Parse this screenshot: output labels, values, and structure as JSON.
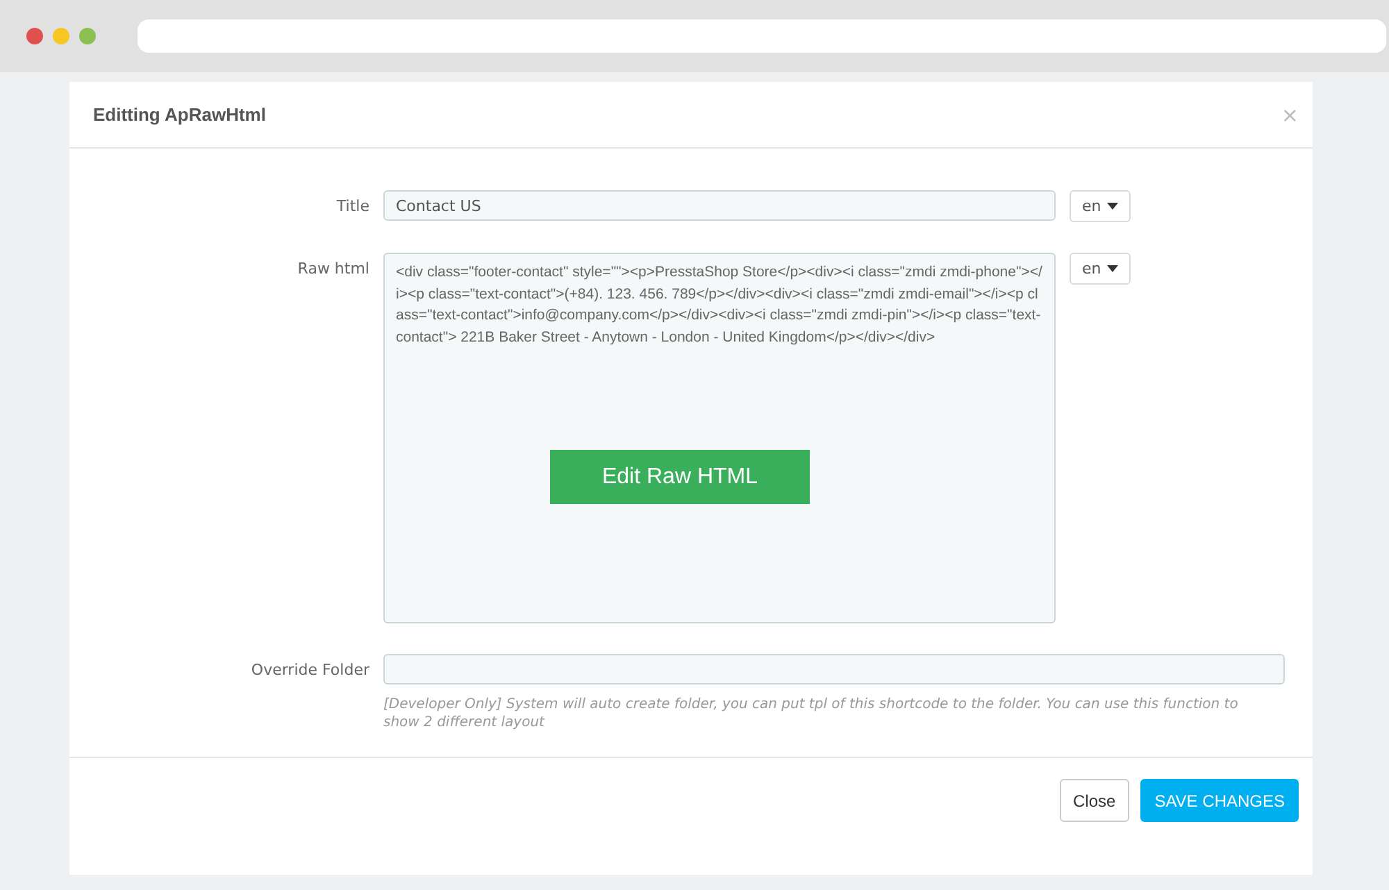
{
  "modal": {
    "title": "Editting ApRawHtml",
    "close_icon": "×"
  },
  "fields": [
    {
      "kind": "input",
      "label": "Title",
      "value": "Contact US",
      "lang": "en"
    },
    {
      "kind": "code",
      "label": "Raw html",
      "value": "<div class=\"footer-contact\" style=\"\"><p>PresstaShop Store</p><div><i class=\"zmdi zmdi-phone\"></i><p class=\"text-contact\">(+84). 123. 456. 789</p></div><div><i class=\"zmdi zmdi-email\"></i><p class=\"text-contact\">info@company.com</p></div><div><i class=\"zmdi zmdi-pin\"></i><p class=\"text-contact\"> 221B Baker Street - Anytown - London - United Kingdom</p></div></div>",
      "lang": "en",
      "action": "Edit Raw HTML"
    },
    {
      "kind": "wide",
      "label": "Override Folder",
      "help": "[Developer Only] System will auto create folder, you can put tpl of this shortcode to the folder. You can use this function to show 2 different layout"
    }
  ],
  "buttons": [
    {
      "label": "Close",
      "kind": "default"
    },
    {
      "label": "SAVE CHANGES",
      "kind": "primary"
    }
  ]
}
